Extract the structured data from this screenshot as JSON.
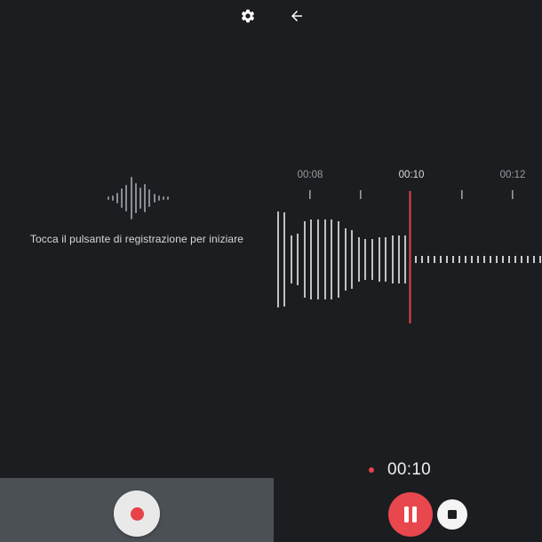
{
  "topbar": {
    "settings_icon": "gear-icon",
    "back_icon": "arrow-left-icon"
  },
  "idle": {
    "hint": "Tocca il pulsante di registrazione per iniziare"
  },
  "timeline": {
    "labels": [
      "00:08",
      "00:10",
      "00:12"
    ],
    "playhead_color": "#e8424a"
  },
  "controls": {
    "elapsed": "00:10",
    "record_icon": "record-icon",
    "pause_icon": "pause-icon",
    "stop_icon": "stop-icon"
  },
  "colors": {
    "background": "#1c1d20",
    "panel": "#4b5055",
    "accent": "#e8424a"
  }
}
